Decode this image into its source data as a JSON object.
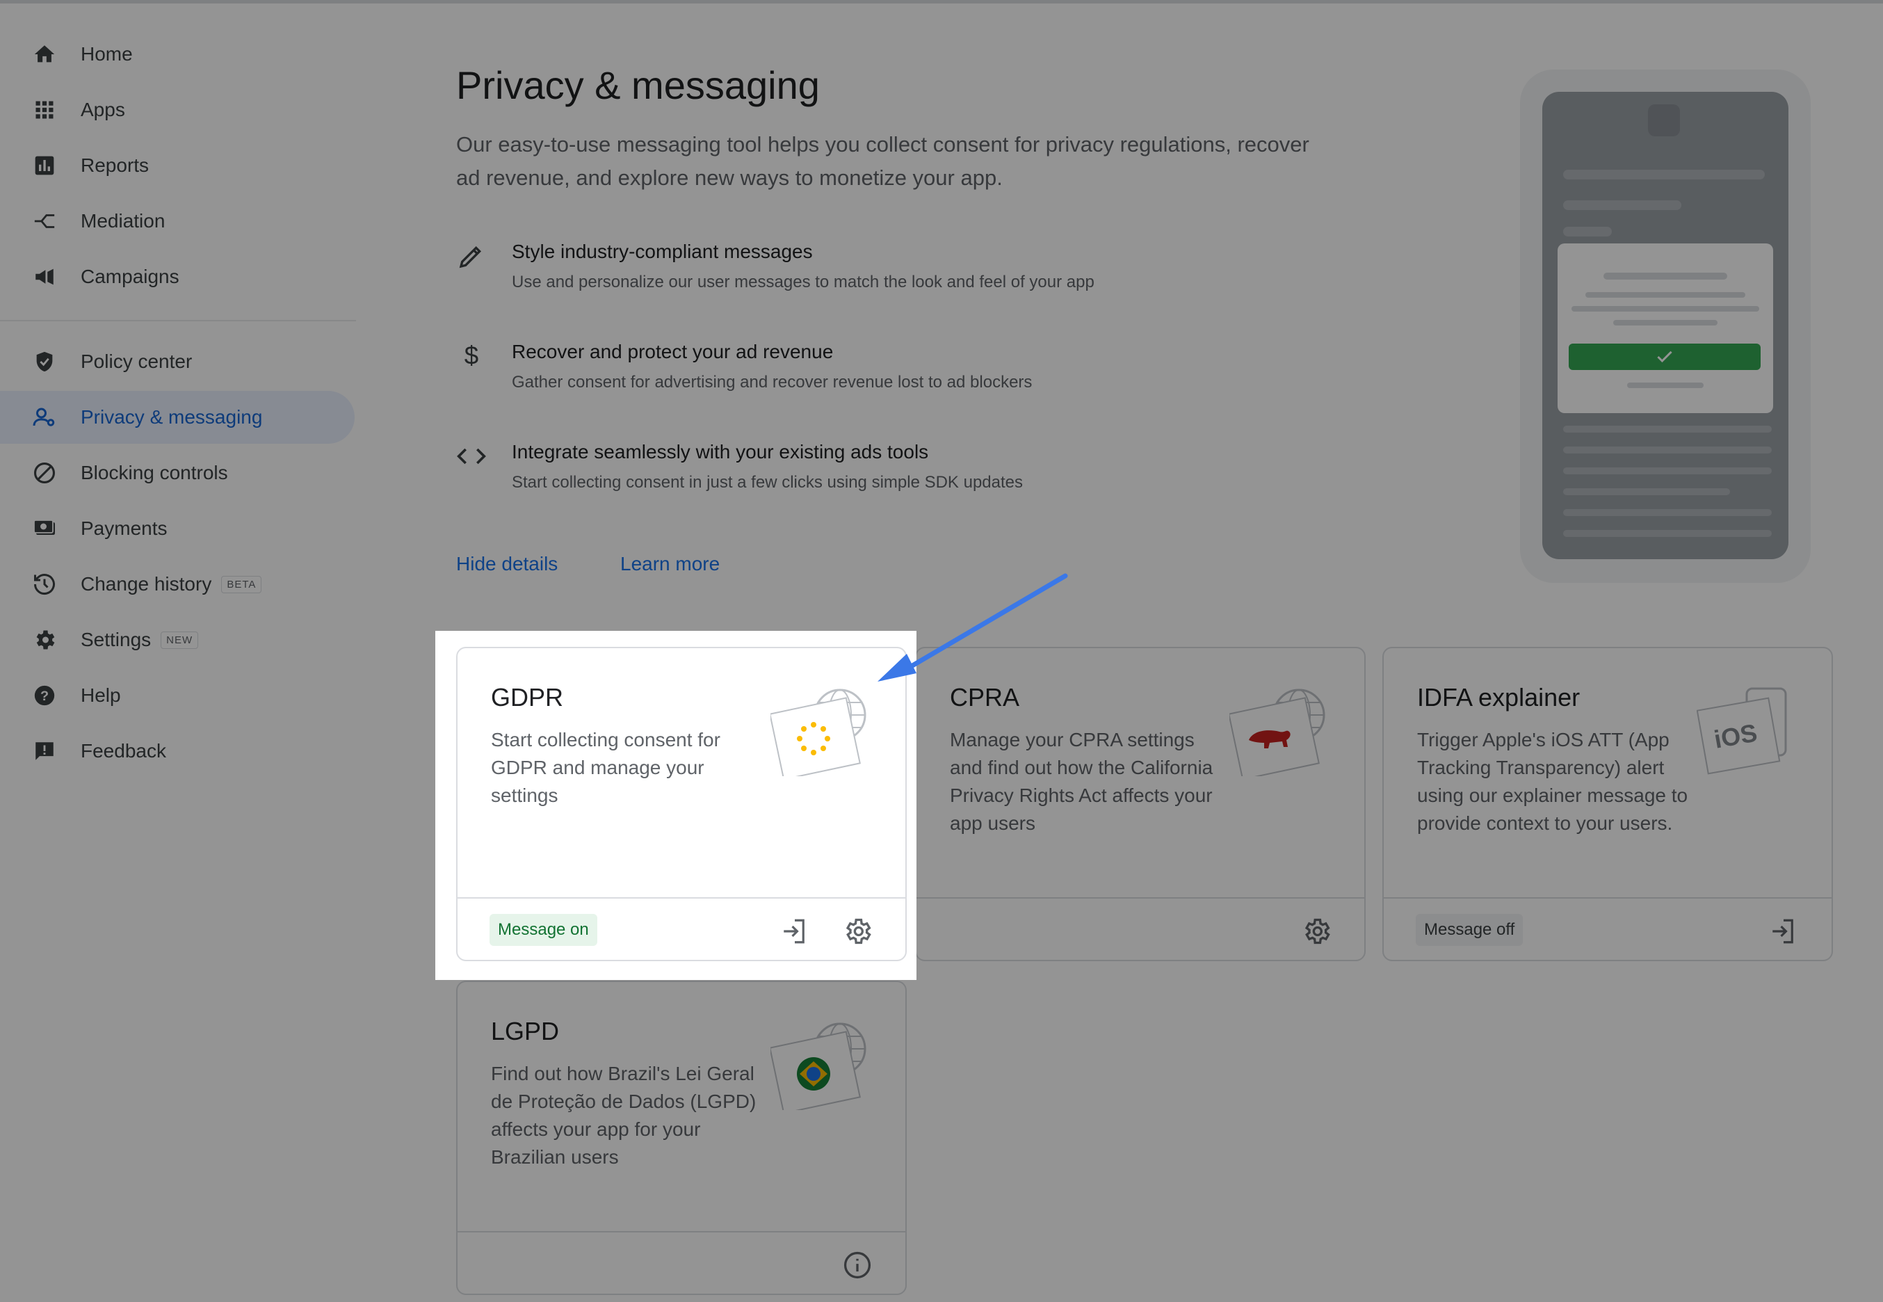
{
  "sidebar": {
    "items": [
      {
        "label": "Home",
        "icon": "home-icon"
      },
      {
        "label": "Apps",
        "icon": "apps-grid-icon"
      },
      {
        "label": "Reports",
        "icon": "bar-chart-icon"
      },
      {
        "label": "Mediation",
        "icon": "mediation-icon"
      },
      {
        "label": "Campaigns",
        "icon": "megaphone-icon"
      },
      {
        "label": "Policy center",
        "icon": "shield-icon"
      },
      {
        "label": "Privacy & messaging",
        "icon": "person-settings-icon",
        "active": true
      },
      {
        "label": "Blocking controls",
        "icon": "block-icon"
      },
      {
        "label": "Payments",
        "icon": "payments-icon"
      },
      {
        "label": "Change history",
        "icon": "history-icon",
        "tag": "BETA"
      },
      {
        "label": "Settings",
        "icon": "gear-icon",
        "tag": "NEW"
      },
      {
        "label": "Help",
        "icon": "help-icon"
      },
      {
        "label": "Feedback",
        "icon": "feedback-icon"
      }
    ]
  },
  "main": {
    "title": "Privacy & messaging",
    "intro": "Our easy-to-use messaging tool helps you collect consent for privacy regulations, recover ad revenue, and explore new ways to monetize your app.",
    "features": [
      {
        "heading": "Style industry-compliant messages",
        "desc": "Use and personalize our user messages to match the look and feel of your app",
        "icon": "pencil-icon"
      },
      {
        "heading": "Recover and protect your ad revenue",
        "desc": "Gather consent for advertising and recover revenue lost to ad blockers",
        "icon": "dollar-icon"
      },
      {
        "heading": "Integrate seamlessly with your existing ads tools",
        "desc": "Start collecting consent in just a few clicks using simple SDK updates",
        "icon": "code-icon"
      }
    ],
    "hide_details": "Hide details",
    "learn_more": "Learn more"
  },
  "cards": {
    "gdpr": {
      "title": "GDPR",
      "desc": "Start collecting consent for GDPR and manage your settings",
      "status": "Message on"
    },
    "cpra": {
      "title": "CPRA",
      "desc": "Manage your CPRA settings and find out how the California Privacy Rights Act affects your app users"
    },
    "idfa": {
      "title": "IDFA explainer",
      "desc": "Trigger Apple's iOS ATT (App Tracking Transparency) alert using our explainer message to provide context to your users.",
      "status": "Message off"
    },
    "lgpd": {
      "title": "LGPD",
      "desc": "Find out how Brazil's Lei Geral de Proteção de Dados (LGPD) affects your app for your Brazilian users"
    }
  },
  "colors": {
    "accent": "#1a73e8",
    "active_bg": "#e8f0fe",
    "arrow": "#3b78e7"
  }
}
